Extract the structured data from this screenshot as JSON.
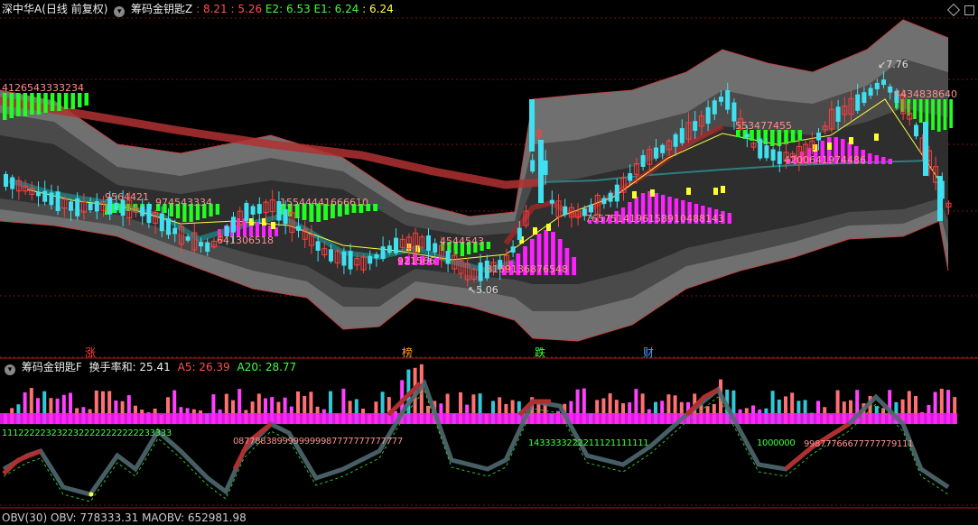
{
  "main_header": {
    "stock": "深中华A(日线 前复权)",
    "indicator": "筹码金钥匙Z",
    "values": [
      {
        "text": ": 8.21",
        "color": "#ff5050"
      },
      {
        "text": ": 5.26",
        "color": "#ff5050"
      },
      {
        "text": "E2: 6.53",
        "color": "#40ff40"
      },
      {
        "text": "E1: 6.24",
        "color": "#40ff40"
      },
      {
        "text": ": 6.24",
        "color": "#ffff40"
      }
    ]
  },
  "sub_header": {
    "indicator": "筹码金钥匙F",
    "label": "换手率和: 25.41",
    "a5": "A5: 26.39",
    "a20": "A20: 28.77"
  },
  "bottom_header": {
    "text": "OBV(30)  OBV: 778333.31  MAOBV: 652981.98"
  },
  "price_labels": {
    "high": "7.76",
    "low": "5.06"
  },
  "event_tags": [
    {
      "text": "涨",
      "color": "#ff4040"
    },
    {
      "text": "榜",
      "color": "#ffa020"
    },
    {
      "text": "跌",
      "color": "#40ff40"
    },
    {
      "text": "财",
      "color": "#40a0ff"
    }
  ],
  "digit_strings": [
    {
      "text": "4126543333234",
      "color": "#ff9090"
    },
    {
      "text": "9564421",
      "color": "#ff9090"
    },
    {
      "text": "974543334",
      "color": "#ff9090"
    },
    {
      "text": "15544441666610",
      "color": "#ff9090"
    },
    {
      "text": "641306518",
      "color": "#ff9090"
    },
    {
      "text": "921566",
      "color": "#ff9090"
    },
    {
      "text": "4544543",
      "color": "#ff9090"
    },
    {
      "text": "8169136876548",
      "color": "#ff9090"
    },
    {
      "text": "7657514196158910488143",
      "color": "#ff9090"
    },
    {
      "text": "553477455",
      "color": "#ff9090"
    },
    {
      "text": "4200641974486",
      "color": "#ff9090"
    },
    {
      "text": "4434838640",
      "color": "#ff9090"
    }
  ],
  "turnover_digits": [
    {
      "text": "1112222232322322222222222233333",
      "color": "#40ff40"
    },
    {
      "text": "0877883899999999987777777777777",
      "color": "#ff9090"
    },
    {
      "text": "1433333222211121111111",
      "color": "#40ff40"
    },
    {
      "text": "1000000",
      "color": "#40ff40"
    },
    {
      "text": "99877766677777779111",
      "color": "#ff9090"
    }
  ],
  "colors": {
    "up": "#ff4040",
    "down": "#40e0f0",
    "band_outer": "#707070",
    "band_mid": "#4a4a4a",
    "band_inner": "#2e2e2e",
    "ma_red": "#b03030",
    "ma_teal": "#2c7f7f",
    "green_bar": "#20ff20",
    "magenta_bar": "#ff20ff",
    "yellow_bar": "#ffff30",
    "grid": "#7a1010"
  }
}
